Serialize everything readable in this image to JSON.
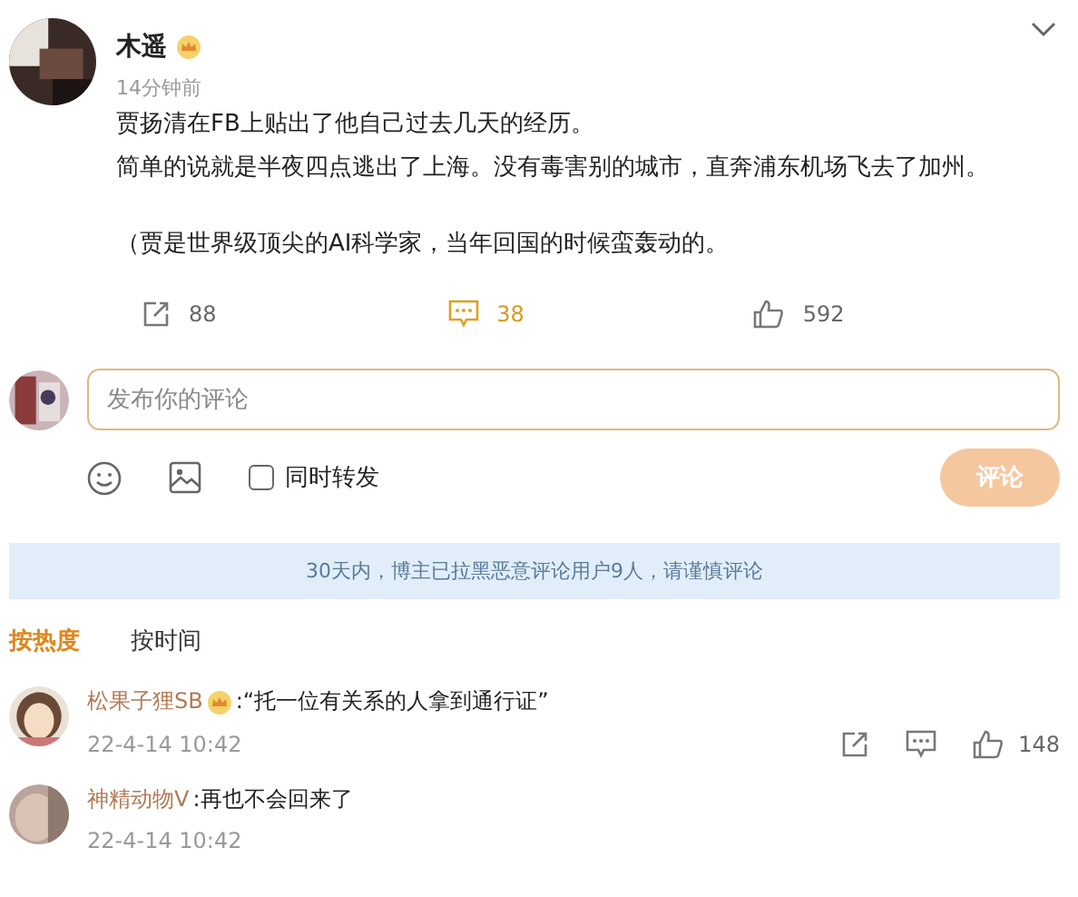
{
  "post": {
    "author": "木遥",
    "verified": true,
    "time": "14分钟前",
    "paragraphs": [
      "贾扬清在FB上贴出了他自己过去几天的经历。",
      "简单的说就是半夜四点逃出了上海。没有毒害别的城市，直奔浦东机场飞去了加州。",
      "（贾是世界级顶尖的AI科学家，当年回国的时候蛮轰动的。"
    ],
    "reposts": "88",
    "comments": "38",
    "likes": "592"
  },
  "composer": {
    "placeholder": "发布你的评论",
    "also_repost": {
      "label": "同时转发",
      "checked": false
    },
    "submit": {
      "label": "评论",
      "disabled": true
    }
  },
  "notice": "30天内，博主已拉黑恶意评论用户9人，请谨慎评论",
  "sort_tabs": [
    {
      "label": "按热度",
      "selected": true
    },
    {
      "label": "按时间",
      "selected": false
    }
  ],
  "comment_list": [
    {
      "author": "松果子狸SB",
      "verified": true,
      "text": ":“托一位有关系的人拿到通行证”",
      "time": "22-4-14 10:42",
      "likes": "148",
      "show_actions": true
    },
    {
      "author": "神精动物V",
      "verified": false,
      "text": ":再也不会回来了",
      "time": "22-4-14 10:42",
      "show_actions": false
    }
  ]
}
